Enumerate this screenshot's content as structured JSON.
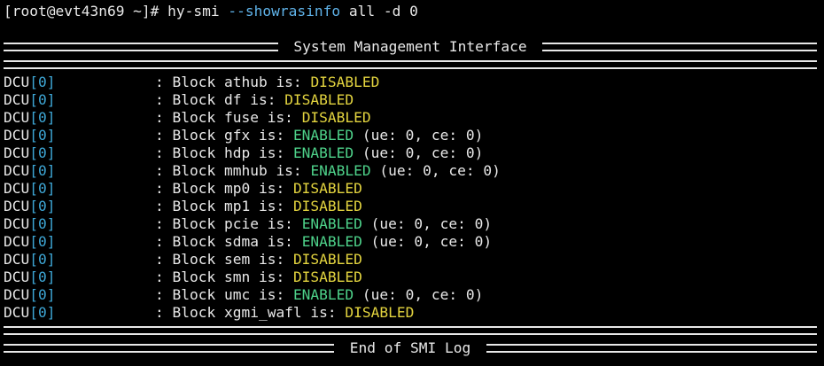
{
  "prompt": {
    "text": "[root@evt43n69 ~]# ",
    "cmd_name": "hy-smi ",
    "cmd_flag": "--showrasinfo",
    "cmd_args": " all -d 0"
  },
  "header": {
    "title": " System Management Interface "
  },
  "rows": [
    {
      "dcu": "DCU",
      "idx": "[0]",
      "text": ": Block athub is: ",
      "status": "DISABLED",
      "extra": ""
    },
    {
      "dcu": "DCU",
      "idx": "[0]",
      "text": ": Block df is: ",
      "status": "DISABLED",
      "extra": ""
    },
    {
      "dcu": "DCU",
      "idx": "[0]",
      "text": ": Block fuse is: ",
      "status": "DISABLED",
      "extra": ""
    },
    {
      "dcu": "DCU",
      "idx": "[0]",
      "text": ": Block gfx is: ",
      "status": "ENABLED",
      "extra": " (ue: 0, ce: 0)"
    },
    {
      "dcu": "DCU",
      "idx": "[0]",
      "text": ": Block hdp is: ",
      "status": "ENABLED",
      "extra": " (ue: 0, ce: 0)"
    },
    {
      "dcu": "DCU",
      "idx": "[0]",
      "text": ": Block mmhub is: ",
      "status": "ENABLED",
      "extra": " (ue: 0, ce: 0)"
    },
    {
      "dcu": "DCU",
      "idx": "[0]",
      "text": ": Block mp0 is: ",
      "status": "DISABLED",
      "extra": ""
    },
    {
      "dcu": "DCU",
      "idx": "[0]",
      "text": ": Block mp1 is: ",
      "status": "DISABLED",
      "extra": ""
    },
    {
      "dcu": "DCU",
      "idx": "[0]",
      "text": ": Block pcie is: ",
      "status": "ENABLED",
      "extra": " (ue: 0, ce: 0)"
    },
    {
      "dcu": "DCU",
      "idx": "[0]",
      "text": ": Block sdma is: ",
      "status": "ENABLED",
      "extra": " (ue: 0, ce: 0)"
    },
    {
      "dcu": "DCU",
      "idx": "[0]",
      "text": ": Block sem is: ",
      "status": "DISABLED",
      "extra": ""
    },
    {
      "dcu": "DCU",
      "idx": "[0]",
      "text": ": Block smn is: ",
      "status": "DISABLED",
      "extra": ""
    },
    {
      "dcu": "DCU",
      "idx": "[0]",
      "text": ": Block umc is: ",
      "status": "ENABLED",
      "extra": " (ue: 0, ce: 0)"
    },
    {
      "dcu": "DCU",
      "idx": "[0]",
      "text": ": Block xgmi_wafl is: ",
      "status": "DISABLED",
      "extra": ""
    }
  ],
  "footer": {
    "title": " End of SMI Log "
  },
  "colors": {
    "background": "#000000",
    "foreground": "#e8e8e8",
    "flag": "#5fb2e8",
    "index": "#3ea7d6",
    "disabled": "#e3d43f",
    "enabled": "#4ed28a"
  }
}
